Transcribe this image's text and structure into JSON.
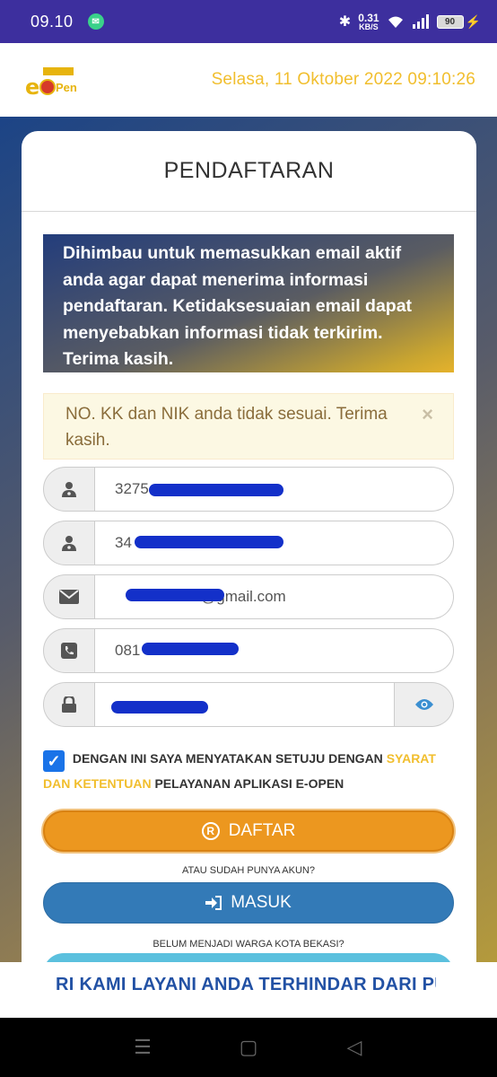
{
  "status_bar": {
    "time": "09.10",
    "net_speed_value": "0.31",
    "net_speed_unit": "KB/S",
    "battery": "90"
  },
  "header": {
    "logo_letter": "e",
    "logo_text": "Pen",
    "datetime": "Selasa, 11 Oktober 2022 09:10:26"
  },
  "card": {
    "title": "PENDAFTARAN",
    "info": "Dihimbau untuk memasukkan email aktif anda agar dapat menerima informasi pendaftaran. Ketidaksesuaian email dapat menyebabkan informasi tidak terkirim. Terima kasih.",
    "alert": {
      "text": "NO. KK dan NIK anda tidak sesuai. Terima kasih.",
      "close": "×"
    },
    "fields": {
      "kk": "3275",
      "nik": "34",
      "email": "@gmail.com",
      "phone": "081",
      "password": ""
    },
    "agree": {
      "prefix": "DENGAN INI SAYA MENYATAKAN SETUJU DENGAN",
      "link": "SYARAT DAN KETENTUAN",
      "suffix": "PELAYANAN APLIKASI E-OPEN"
    },
    "daftar_label": "DAFTAR",
    "have_account_text": "ATAU SUDAH PUNYA AKUN?",
    "masuk_label": "MASUK",
    "not_resident_text": "BELUM MENJADI WARGA KOTA BEKASI?"
  },
  "marquee_text": "RI KAMI LAYANI ANDA TERHINDAR DARI PU",
  "icons": [
    "user-md-icon",
    "envelope-icon",
    "phone-icon",
    "lock-icon",
    "eye-icon",
    "registered-icon",
    "sign-in-icon"
  ],
  "colors": {
    "accent_yellow": "#f1be2d",
    "primary_blue": "#337ab7",
    "warning_orange": "#ec971f",
    "status_bar": "#3d2f9e"
  }
}
